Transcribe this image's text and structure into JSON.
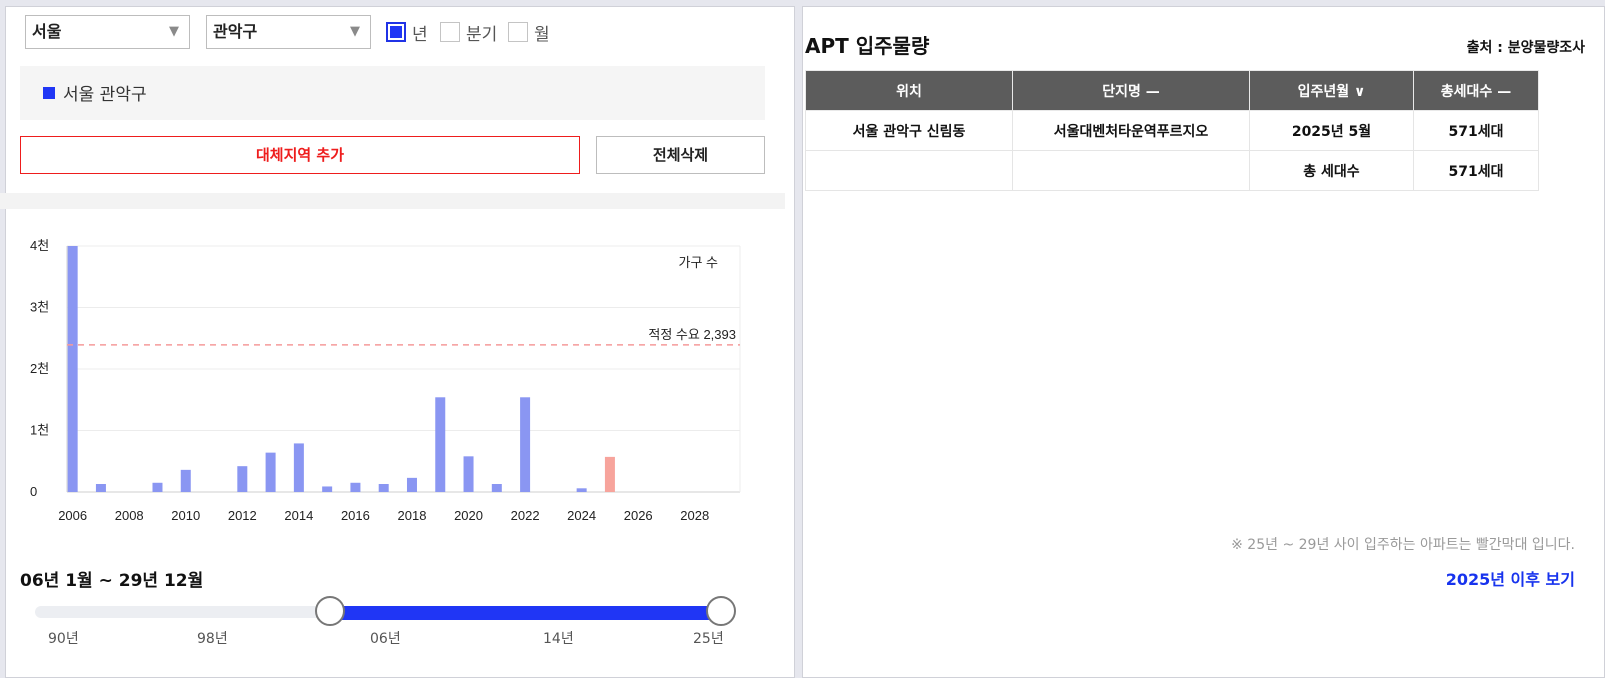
{
  "filters": {
    "city": "서울",
    "district": "관악구",
    "period_options": [
      {
        "label": "년",
        "checked": true
      },
      {
        "label": "분기",
        "checked": false
      },
      {
        "label": "월",
        "checked": false
      }
    ]
  },
  "selected_region": "서울 관악구",
  "buttons": {
    "add_region": "대체지역 추가",
    "clear_all": "전체삭제"
  },
  "chart_data": {
    "type": "bar",
    "ylabel": "가구 수",
    "y_ticks": [
      "0",
      "1천",
      "2천",
      "3천",
      "4천"
    ],
    "ylim": [
      0,
      4000
    ],
    "x_ticks": [
      "2006",
      "2008",
      "2010",
      "2012",
      "2014",
      "2016",
      "2018",
      "2020",
      "2022",
      "2024",
      "2026",
      "2028"
    ],
    "xlim": [
      2005.8,
      2029.6
    ],
    "years": [
      2006,
      2007,
      2009,
      2010,
      2012,
      2013,
      2014,
      2015,
      2016,
      2017,
      2018,
      2019,
      2020,
      2021,
      2022,
      2024,
      2025
    ],
    "values": [
      4000,
      130,
      150,
      360,
      420,
      640,
      790,
      90,
      150,
      130,
      230,
      1540,
      580,
      130,
      1540,
      60,
      571
    ],
    "highlight_years": [
      2025
    ],
    "threshold": {
      "label": "적정 수요 2,393",
      "value": 2393
    },
    "colors": {
      "bar": "#8a96f2",
      "highlight": "#f7a49c",
      "threshold": "#f59a9a"
    }
  },
  "chart_note": "※ 25년 ~ 29년 사이 입주하는 아파트는 빨간막대 입니다.",
  "period_range": "06년 1월 ~ 29년 12월",
  "after_link": "2025년 이후 보기",
  "slider": {
    "labels": [
      "90년",
      "98년",
      "06년",
      "14년",
      "25년"
    ]
  },
  "apt": {
    "title": "APT 입주물량",
    "source": "출처 : 분양물량조사",
    "columns": [
      "위치",
      "단지명 —",
      "입주년월 ∨",
      "총세대수 —"
    ],
    "rows": [
      [
        "서울 관악구 신림동",
        "서울대벤처타운역푸르지오",
        "2025년 5월",
        "571세대"
      ],
      [
        "",
        "",
        "총 세대수",
        "571세대"
      ]
    ]
  }
}
